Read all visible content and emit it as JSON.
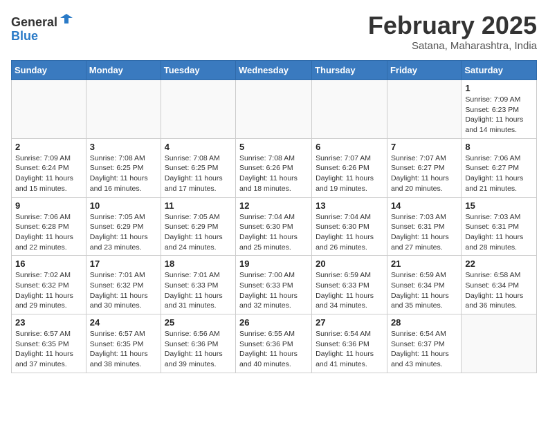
{
  "header": {
    "logo_line1": "General",
    "logo_line2": "Blue",
    "month_title": "February 2025",
    "subtitle": "Satana, Maharashtra, India"
  },
  "weekdays": [
    "Sunday",
    "Monday",
    "Tuesday",
    "Wednesday",
    "Thursday",
    "Friday",
    "Saturday"
  ],
  "weeks": [
    [
      {
        "day": "",
        "info": ""
      },
      {
        "day": "",
        "info": ""
      },
      {
        "day": "",
        "info": ""
      },
      {
        "day": "",
        "info": ""
      },
      {
        "day": "",
        "info": ""
      },
      {
        "day": "",
        "info": ""
      },
      {
        "day": "1",
        "info": "Sunrise: 7:09 AM\nSunset: 6:23 PM\nDaylight: 11 hours\nand 14 minutes."
      }
    ],
    [
      {
        "day": "2",
        "info": "Sunrise: 7:09 AM\nSunset: 6:24 PM\nDaylight: 11 hours\nand 15 minutes."
      },
      {
        "day": "3",
        "info": "Sunrise: 7:08 AM\nSunset: 6:25 PM\nDaylight: 11 hours\nand 16 minutes."
      },
      {
        "day": "4",
        "info": "Sunrise: 7:08 AM\nSunset: 6:25 PM\nDaylight: 11 hours\nand 17 minutes."
      },
      {
        "day": "5",
        "info": "Sunrise: 7:08 AM\nSunset: 6:26 PM\nDaylight: 11 hours\nand 18 minutes."
      },
      {
        "day": "6",
        "info": "Sunrise: 7:07 AM\nSunset: 6:26 PM\nDaylight: 11 hours\nand 19 minutes."
      },
      {
        "day": "7",
        "info": "Sunrise: 7:07 AM\nSunset: 6:27 PM\nDaylight: 11 hours\nand 20 minutes."
      },
      {
        "day": "8",
        "info": "Sunrise: 7:06 AM\nSunset: 6:27 PM\nDaylight: 11 hours\nand 21 minutes."
      }
    ],
    [
      {
        "day": "9",
        "info": "Sunrise: 7:06 AM\nSunset: 6:28 PM\nDaylight: 11 hours\nand 22 minutes."
      },
      {
        "day": "10",
        "info": "Sunrise: 7:05 AM\nSunset: 6:29 PM\nDaylight: 11 hours\nand 23 minutes."
      },
      {
        "day": "11",
        "info": "Sunrise: 7:05 AM\nSunset: 6:29 PM\nDaylight: 11 hours\nand 24 minutes."
      },
      {
        "day": "12",
        "info": "Sunrise: 7:04 AM\nSunset: 6:30 PM\nDaylight: 11 hours\nand 25 minutes."
      },
      {
        "day": "13",
        "info": "Sunrise: 7:04 AM\nSunset: 6:30 PM\nDaylight: 11 hours\nand 26 minutes."
      },
      {
        "day": "14",
        "info": "Sunrise: 7:03 AM\nSunset: 6:31 PM\nDaylight: 11 hours\nand 27 minutes."
      },
      {
        "day": "15",
        "info": "Sunrise: 7:03 AM\nSunset: 6:31 PM\nDaylight: 11 hours\nand 28 minutes."
      }
    ],
    [
      {
        "day": "16",
        "info": "Sunrise: 7:02 AM\nSunset: 6:32 PM\nDaylight: 11 hours\nand 29 minutes."
      },
      {
        "day": "17",
        "info": "Sunrise: 7:01 AM\nSunset: 6:32 PM\nDaylight: 11 hours\nand 30 minutes."
      },
      {
        "day": "18",
        "info": "Sunrise: 7:01 AM\nSunset: 6:33 PM\nDaylight: 11 hours\nand 31 minutes."
      },
      {
        "day": "19",
        "info": "Sunrise: 7:00 AM\nSunset: 6:33 PM\nDaylight: 11 hours\nand 32 minutes."
      },
      {
        "day": "20",
        "info": "Sunrise: 6:59 AM\nSunset: 6:33 PM\nDaylight: 11 hours\nand 34 minutes."
      },
      {
        "day": "21",
        "info": "Sunrise: 6:59 AM\nSunset: 6:34 PM\nDaylight: 11 hours\nand 35 minutes."
      },
      {
        "day": "22",
        "info": "Sunrise: 6:58 AM\nSunset: 6:34 PM\nDaylight: 11 hours\nand 36 minutes."
      }
    ],
    [
      {
        "day": "23",
        "info": "Sunrise: 6:57 AM\nSunset: 6:35 PM\nDaylight: 11 hours\nand 37 minutes."
      },
      {
        "day": "24",
        "info": "Sunrise: 6:57 AM\nSunset: 6:35 PM\nDaylight: 11 hours\nand 38 minutes."
      },
      {
        "day": "25",
        "info": "Sunrise: 6:56 AM\nSunset: 6:36 PM\nDaylight: 11 hours\nand 39 minutes."
      },
      {
        "day": "26",
        "info": "Sunrise: 6:55 AM\nSunset: 6:36 PM\nDaylight: 11 hours\nand 40 minutes."
      },
      {
        "day": "27",
        "info": "Sunrise: 6:54 AM\nSunset: 6:36 PM\nDaylight: 11 hours\nand 41 minutes."
      },
      {
        "day": "28",
        "info": "Sunrise: 6:54 AM\nSunset: 6:37 PM\nDaylight: 11 hours\nand 43 minutes."
      },
      {
        "day": "",
        "info": ""
      }
    ]
  ]
}
